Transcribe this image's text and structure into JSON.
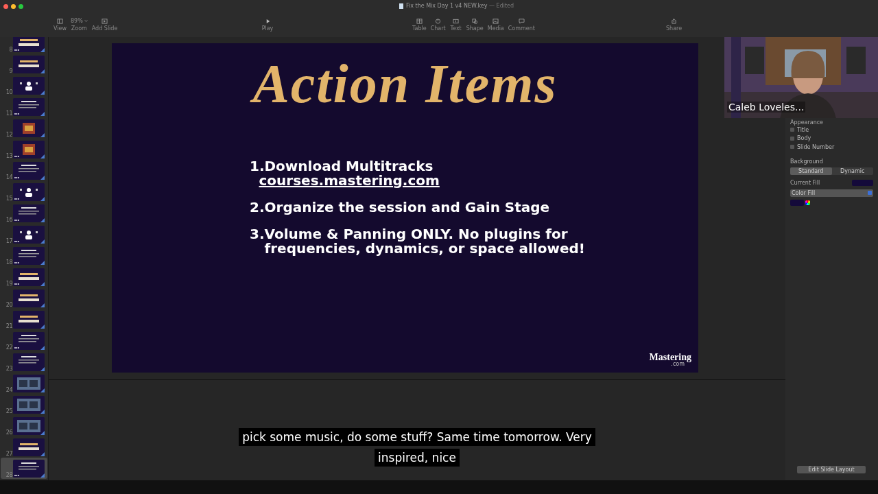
{
  "window": {
    "title": "Fix the Mix Day 1 v4 NEW.key",
    "status": "— Edited"
  },
  "toolbar": {
    "left": [
      {
        "label": "View",
        "kind": "view"
      },
      {
        "label": "Zoom",
        "kind": "zoom",
        "value": "89%"
      },
      {
        "label": "Add Slide",
        "kind": "add"
      }
    ],
    "center": [
      {
        "label": "Play",
        "kind": "play"
      }
    ],
    "insert": [
      {
        "label": "Table",
        "kind": "table"
      },
      {
        "label": "Chart",
        "kind": "chart"
      },
      {
        "label": "Text",
        "kind": "text"
      },
      {
        "label": "Shape",
        "kind": "shape"
      },
      {
        "label": "Media",
        "kind": "media"
      },
      {
        "label": "Comment",
        "kind": "comment"
      }
    ],
    "right": [
      {
        "label": "Share",
        "kind": "share"
      }
    ]
  },
  "slides": [
    {
      "number": "8",
      "kind": "title",
      "builds": true,
      "selected": false
    },
    {
      "number": "9",
      "kind": "title",
      "builds": false,
      "selected": false
    },
    {
      "number": "10",
      "kind": "figure",
      "builds": false,
      "selected": false
    },
    {
      "number": "11",
      "kind": "text",
      "builds": true,
      "selected": false
    },
    {
      "number": "12",
      "builds": false,
      "selected": false
    },
    {
      "number": "13",
      "builds": true,
      "selected": false
    },
    {
      "number": "14",
      "kind": "text",
      "builds": true,
      "selected": false
    },
    {
      "number": "15",
      "kind": "figure",
      "builds": true,
      "selected": false
    },
    {
      "number": "16",
      "kind": "text",
      "builds": true,
      "selected": false
    },
    {
      "number": "17",
      "kind": "figure",
      "builds": true,
      "selected": false
    },
    {
      "number": "18",
      "kind": "text",
      "builds": true,
      "selected": false
    },
    {
      "number": "19",
      "kind": "title",
      "builds": true,
      "selected": false
    },
    {
      "number": "20",
      "kind": "title",
      "builds": false,
      "selected": false
    },
    {
      "number": "21",
      "kind": "title",
      "builds": false,
      "selected": false
    },
    {
      "number": "22",
      "kind": "text",
      "builds": true,
      "selected": false
    },
    {
      "number": "23",
      "kind": "text",
      "builds": false,
      "selected": false
    },
    {
      "number": "24",
      "kind": "screenshot",
      "builds": false,
      "selected": false
    },
    {
      "number": "25",
      "kind": "screenshot",
      "builds": false,
      "selected": false
    },
    {
      "number": "26",
      "kind": "screenshot",
      "builds": false,
      "selected": false
    },
    {
      "number": "27",
      "kind": "title",
      "builds": false,
      "selected": false
    },
    {
      "number": "28",
      "kind": "text",
      "builds": true,
      "selected": true
    }
  ],
  "slide": {
    "title": "Action Items",
    "items": [
      {
        "number": "1.",
        "text": "Download Multitracks",
        "link": "courses.mastering.com"
      },
      {
        "number": "2.",
        "text": "Organize the session and Gain Stage"
      },
      {
        "number": "3.",
        "text": " Volume & Panning ONLY. No plugins for frequencies, dynamics, or space allowed!"
      }
    ],
    "logo": {
      "name": "Mastering",
      "suffix": ".com"
    }
  },
  "video": {
    "kind": "picture",
    "name": "Caleb Loveles..."
  },
  "inspector": {
    "section": "Appearance",
    "checkboxes": [
      {
        "label": "Title",
        "checked": false
      },
      {
        "label": "Body",
        "checked": false
      },
      {
        "label": "Slide Number",
        "checked": false
      }
    ],
    "background_label": "Background",
    "segments": [
      {
        "label": "Standard",
        "selected": true
      },
      {
        "label": "Dynamic",
        "selected": false
      }
    ],
    "current_fill_label": "Current Fill",
    "fill_type": "Color Fill",
    "edit_layout": "Edit Slide Layout"
  },
  "caption": "pick some music, do some stuff? Same time tomorrow. Very inspired, nice"
}
